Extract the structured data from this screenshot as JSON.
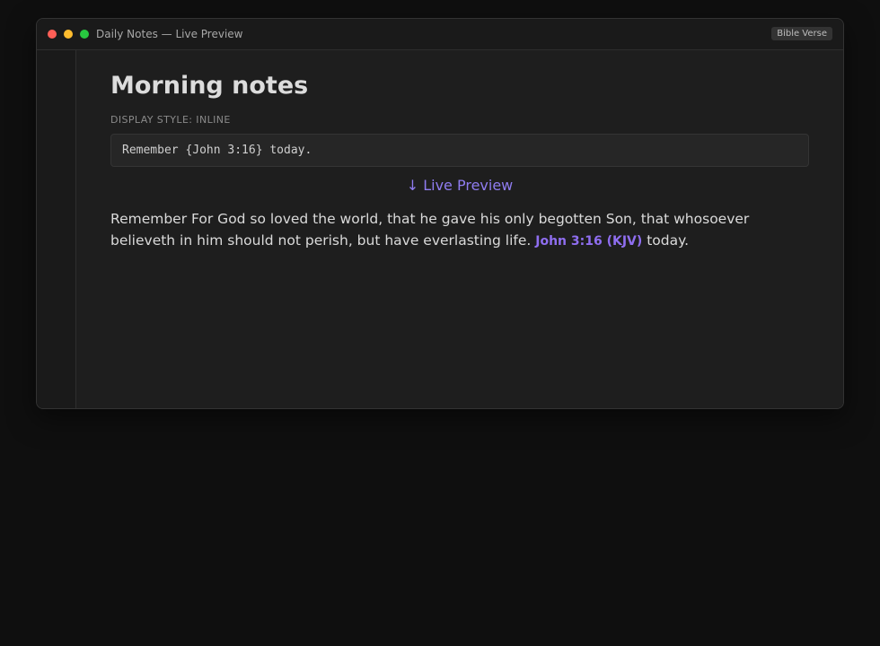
{
  "window": {
    "title": "Daily Notes — Live Preview",
    "badge": "Bible Verse"
  },
  "note": {
    "title": "Morning notes",
    "display_style_label": "DISPLAY STYLE: INLINE",
    "source_code": "Remember {John 3:16} today.",
    "live_preview_label": "↓ Live Preview",
    "preview": {
      "before": "Remember ",
      "verse_text": "For God so loved the world, that he gave his only begotten Son, that whosoever believeth in him should not perish, but have everlasting life.",
      "verse_ref": "John 3:16 (KJV)",
      "after": " today."
    }
  },
  "colors": {
    "accent": "#8f6ef0",
    "background": "#1e1e1e",
    "traffic_red": "#ff5f57",
    "traffic_yellow": "#febc2e",
    "traffic_green": "#28c840"
  }
}
